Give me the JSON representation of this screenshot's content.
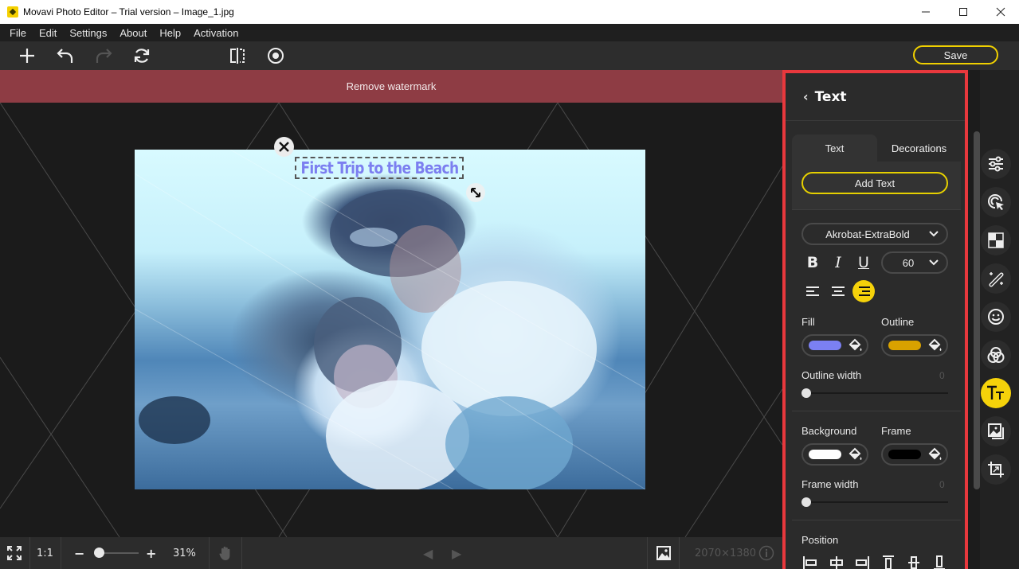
{
  "window": {
    "title": "Movavi Photo Editor – Trial version – Image_1.jpg",
    "minimize": "—",
    "maximize": "☐",
    "close": "✕"
  },
  "menu": [
    "File",
    "Edit",
    "Settings",
    "About",
    "Help",
    "Activation"
  ],
  "toolbar": {
    "icons": [
      "add-icon",
      "undo-icon",
      "redo-icon",
      "rotate-refresh-icon",
      "compare-split-icon",
      "preview-eye-icon"
    ],
    "save_label": "Save"
  },
  "watermark_label": "Remove watermark",
  "canvas": {
    "text_overlay": "First Trip to the Beach",
    "close_glyph": "✕",
    "resize_glyph": "⤡",
    "fill_color": "#7c7ff0"
  },
  "bottom_bar": {
    "fit_icon": "fit-screen-icon",
    "actual_size_label": "1:1",
    "zoom_out": "−",
    "zoom_in": "+",
    "zoom_value": "31%",
    "zoom_fraction": 0.1,
    "hand_icon": "hand-pan-icon",
    "prev": "◀",
    "next": "▶",
    "image_icon": "image-icon",
    "dimensions": "2070×1380",
    "info_glyph": "i"
  },
  "panel": {
    "back_glyph": "‹",
    "title": "Text",
    "tabs": [
      {
        "label": "Text",
        "active": true
      },
      {
        "label": "Decorations",
        "active": false
      }
    ],
    "add_text_label": "Add Text",
    "font": "Akrobat-ExtraBold",
    "font_chevron": "⌄",
    "bold": "B",
    "italic": "I",
    "underline": "U",
    "font_size": "60",
    "alignment_active": "right",
    "fill_label": "Fill",
    "fill_color": "#7b80f2",
    "outline_label": "Outline",
    "outline_color": "#d9a200",
    "outline_width_label": "Outline width",
    "outline_width_value": "0",
    "background_label": "Background",
    "background_color": "#ffffff",
    "frame_label": "Frame",
    "frame_color": "#000000",
    "frame_width_label": "Frame width",
    "frame_width_value": "0",
    "position_label": "Position",
    "position_buttons": [
      "align-left",
      "align-center-horizontal",
      "align-right",
      "align-top",
      "align-center-vertical",
      "align-bottom"
    ]
  },
  "rail": [
    {
      "name": "adjust-sliders-icon",
      "active": false
    },
    {
      "name": "selection-cursor-icon",
      "active": false
    },
    {
      "name": "checkerboard-background-icon",
      "active": false
    },
    {
      "name": "magic-wand-icon",
      "active": false
    },
    {
      "name": "face-smile-icon",
      "active": false
    },
    {
      "name": "color-circles-icon",
      "active": false
    },
    {
      "name": "text-tt-icon",
      "active": true
    },
    {
      "name": "image-overlay-icon",
      "active": false
    },
    {
      "name": "crop-icon",
      "active": false
    }
  ],
  "colors": {
    "accent": "#f5d20a",
    "watermark_bg": "#8e3c44",
    "panel_highlight": "#e8383d"
  }
}
